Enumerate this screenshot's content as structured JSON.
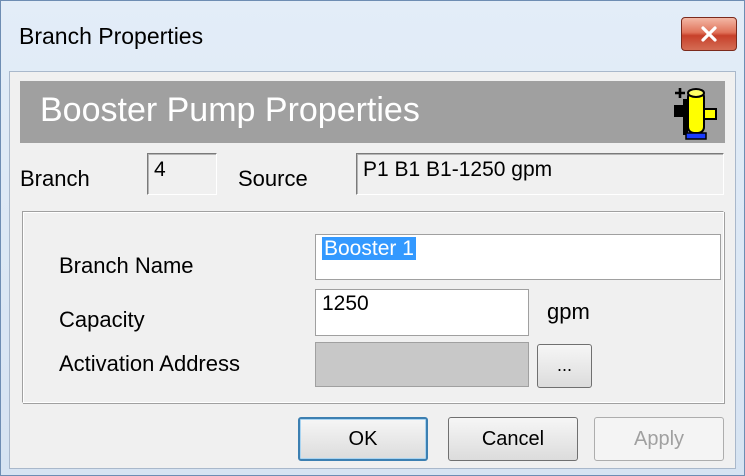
{
  "window": {
    "title": "Branch Properties",
    "close_icon": "close-x-icon"
  },
  "header": {
    "title": "Booster Pump Properties",
    "icon": "booster-pump-icon"
  },
  "branch": {
    "label": "Branch",
    "value": "4"
  },
  "source": {
    "label": "Source",
    "value": "P1 B1 B1-1250 gpm"
  },
  "form": {
    "branch_name_label": "Branch Name",
    "branch_name_value": "Booster 1",
    "capacity_label": "Capacity",
    "capacity_value": "1250",
    "capacity_unit": "gpm",
    "activation_label": "Activation Address",
    "activation_value": "",
    "browse_label": "..."
  },
  "buttons": {
    "ok": "OK",
    "cancel": "Cancel",
    "apply": "Apply"
  },
  "colors": {
    "header_band": "#a0a0a0",
    "selection": "#3399ff",
    "close_button": "#c7402a"
  }
}
